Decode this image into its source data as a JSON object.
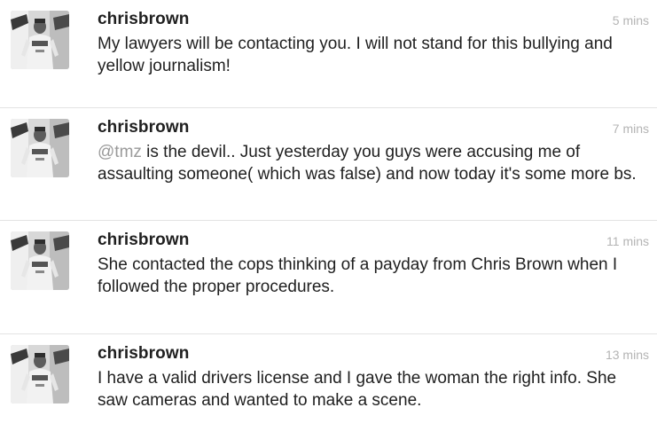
{
  "tweets": [
    {
      "username": "chrisbrown",
      "time": "5 mins",
      "text": "My lawyers will be contacting you. I will not stand for this bullying and yellow journalism!"
    },
    {
      "username": "chrisbrown",
      "time": "7 mins",
      "mention": "@tmz",
      "text": " is the devil.. Just yesterday you guys were accusing me of assaulting someone( which was false) and now today it's some more bs."
    },
    {
      "username": "chrisbrown",
      "time": "11 mins",
      "text": "She contacted the cops thinking of a payday from Chris Brown when I followed the proper procedures."
    },
    {
      "username": "chrisbrown",
      "time": "13 mins",
      "text": "I have a valid drivers license and I gave the woman the right info. She saw cameras and wanted to make a scene."
    }
  ],
  "avatar_icon": "user-photo-icon",
  "colors": {
    "text": "#1f1f1f",
    "timestamp": "#b4b4b4",
    "mention": "#9a9a9a",
    "divider": "#e3e3e3"
  }
}
